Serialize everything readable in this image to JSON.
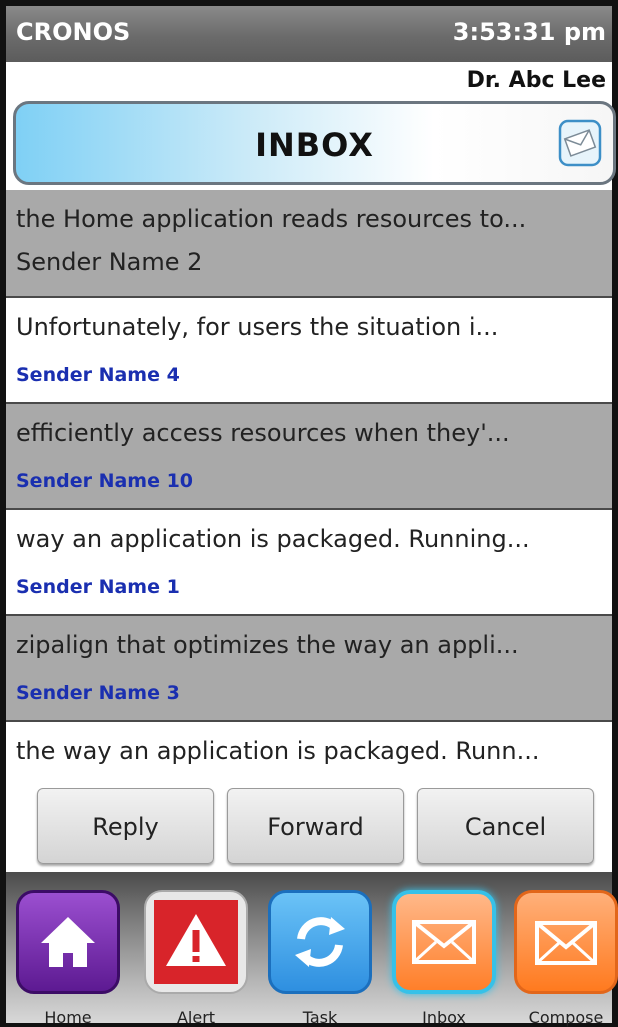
{
  "status": {
    "app_name": "CRONOS",
    "time": "3:53:31 pm"
  },
  "user": {
    "name": "Dr. Abc Lee"
  },
  "header": {
    "title": "INBOX",
    "icon": "envelope-icon"
  },
  "messages": [
    {
      "subject": " the Home application reads resources to...",
      "sender": "Sender Name 2"
    },
    {
      "subject": "Unfortunately, for users the situation i...",
      "sender": "Sender Name 4"
    },
    {
      "subject": " efficiently access resources when they'...",
      "sender": "Sender Name 10"
    },
    {
      "subject": " way an application is packaged. Running...",
      "sender": "Sender Name 1"
    },
    {
      "subject": "zipalign that optimizes the way an appli...",
      "sender": "Sender Name 3"
    },
    {
      "subject": "the way an application is packaged. Runn...",
      "sender": ""
    }
  ],
  "actions": {
    "reply": "Reply",
    "forward": "Forward",
    "cancel": "Cancel"
  },
  "dock": {
    "items": [
      {
        "label": "Home",
        "icon": "home-icon"
      },
      {
        "label": "Alert",
        "icon": "alert-icon"
      },
      {
        "label": "Task",
        "icon": "refresh-icon"
      },
      {
        "label": "Inbox",
        "icon": "envelope-icon"
      },
      {
        "label": "Compose",
        "icon": "envelope-icon"
      }
    ]
  },
  "colors": {
    "sender_link": "#1a2fb0",
    "row_grey": "#a9a9a9",
    "header_accent": "#7fd0f5"
  }
}
